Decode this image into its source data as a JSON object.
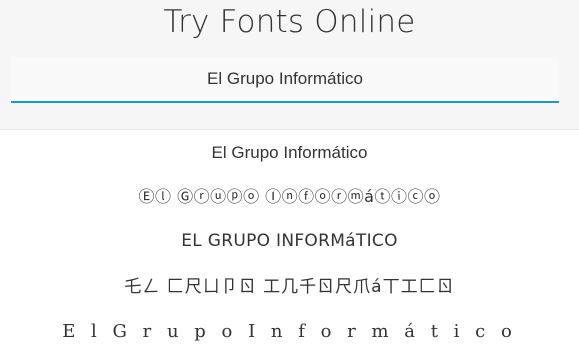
{
  "header": {
    "title": "Try Fonts Online"
  },
  "input": {
    "value": "El Grupo Informático"
  },
  "samples": [
    "El Grupo Informático",
    "Ⓔⓛ Ⓖⓡⓤⓟⓞ Ⓘⓝⓕⓞⓡⓜáⓣⓘⓒⓞ",
    "EL GRUPO INFORMáTICO",
    "乇ㄥ 匚尺ㄩ卩ㄖ 工几千ㄖ尺爪á丅工匚ㄖ",
    "E l  G r u p o  I n f o r m á t i c o"
  ],
  "colors": {
    "accent": "#1a9bc4",
    "text": "#333333",
    "header_bg": "#f6f6f6",
    "results_bg": "#ffffff"
  }
}
